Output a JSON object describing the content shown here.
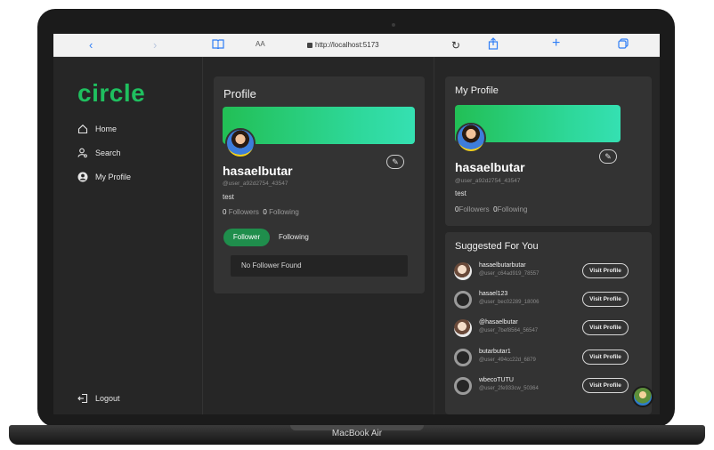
{
  "browser": {
    "url": "http://localhost:5173",
    "text_size_label": "AA"
  },
  "device": {
    "model": "MacBook Air"
  },
  "sidebar": {
    "brand": "circle",
    "items": [
      {
        "label": "Home",
        "icon": "home-icon"
      },
      {
        "label": "Search",
        "icon": "search-user-icon"
      },
      {
        "label": "My Profile",
        "icon": "user-circle-icon"
      }
    ],
    "logout": {
      "label": "Logout",
      "icon": "logout-icon"
    }
  },
  "profile": {
    "title": "Profile",
    "username": "hasaelbutar",
    "handle": "@user_a92d2754_43547",
    "bio": "test",
    "followers_count": "0",
    "followers_label": "Followers",
    "following_count": "0",
    "following_label": "Following",
    "tabs": [
      "Follower",
      "Following"
    ],
    "empty_message": "No Follower Found"
  },
  "my_profile": {
    "title": "My Profile",
    "username": "hasaelbutar",
    "handle": "@user_a92d2754_43547",
    "bio": "test",
    "followers_count": "0",
    "followers_label": "Followers",
    "following_count": "0",
    "following_label": "Following"
  },
  "suggested": {
    "title": "Suggested For You",
    "button_label": "Visit Profile",
    "users": [
      {
        "name": "hasaelbutarbutar",
        "handle": "@user_c64ad919_78557",
        "avatar": "photo"
      },
      {
        "name": "hasael123",
        "handle": "@user_bec02289_18006",
        "avatar": "blank"
      },
      {
        "name": "@hasaelbutar",
        "handle": "@user_7bef8564_56547",
        "avatar": "photo"
      },
      {
        "name": "butarbutar1",
        "handle": "@user_494cc22d_6879",
        "avatar": "blank"
      },
      {
        "name": "wbecoTUTU",
        "handle": "@user_2fe933cw_50364",
        "avatar": "blank"
      }
    ]
  },
  "colors": {
    "brand": "#1fbf5f",
    "active_tab": "#1f8e4c",
    "background": "#262626",
    "card": "#333333"
  }
}
